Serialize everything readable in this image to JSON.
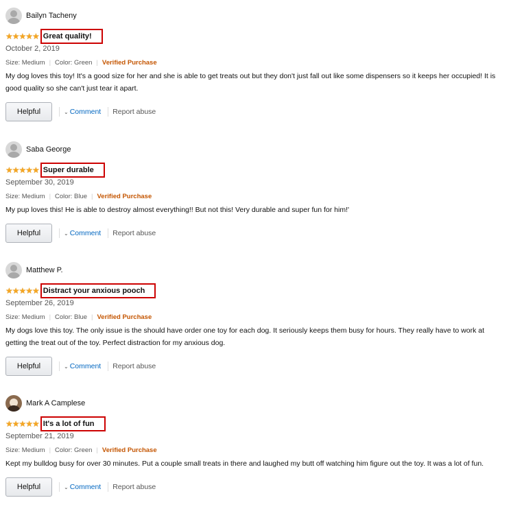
{
  "labels": {
    "size_label": "Size: Medium",
    "verified": "Verified Purchase",
    "helpful": "Helpful",
    "comment": "Comment",
    "report": "Report abuse"
  },
  "colors": {
    "star": "#f5a623",
    "verified": "#c45500",
    "link": "#0066c0",
    "highlight_box": "#cc0000"
  },
  "reviews": [
    {
      "name": "Bailyn Tacheny",
      "rating": 5,
      "title": "Great quality!",
      "date": "October 2, 2019",
      "color": "Color: Green",
      "text": "My dog loves this toy! It's a good size for her and she is able to get treats out but they don't just fall out like some dispensers so it keeps her occupied! It is good quality so she can't just tear it apart."
    },
    {
      "name": "Saba George",
      "rating": 5,
      "title": "Super durable",
      "date": "September 30, 2019",
      "color": "Color: Blue",
      "text": "My pup loves this! He is able to destroy almost everything!! But not this! Very durable and super fun for him!'"
    },
    {
      "name": "Matthew P.",
      "rating": 5,
      "title": "Distract your anxious pooch",
      "date": "September 26, 2019",
      "color": "Color: Blue",
      "text": "My dogs love this toy. The only issue is the should have order one toy for each dog. It seriously keeps them busy for hours. They really have to work at getting the treat out of the toy. Perfect distraction for my anxious dog."
    },
    {
      "name": "Mark A Camplese",
      "rating": 5,
      "title": "It's a lot of fun",
      "date": "September 21, 2019",
      "color": "Color: Green",
      "text": "Kept my bulldog busy for over 30 minutes. Put a couple small treats in there and laughed my butt off watching him figure out the toy. It was a lot of fun."
    }
  ]
}
